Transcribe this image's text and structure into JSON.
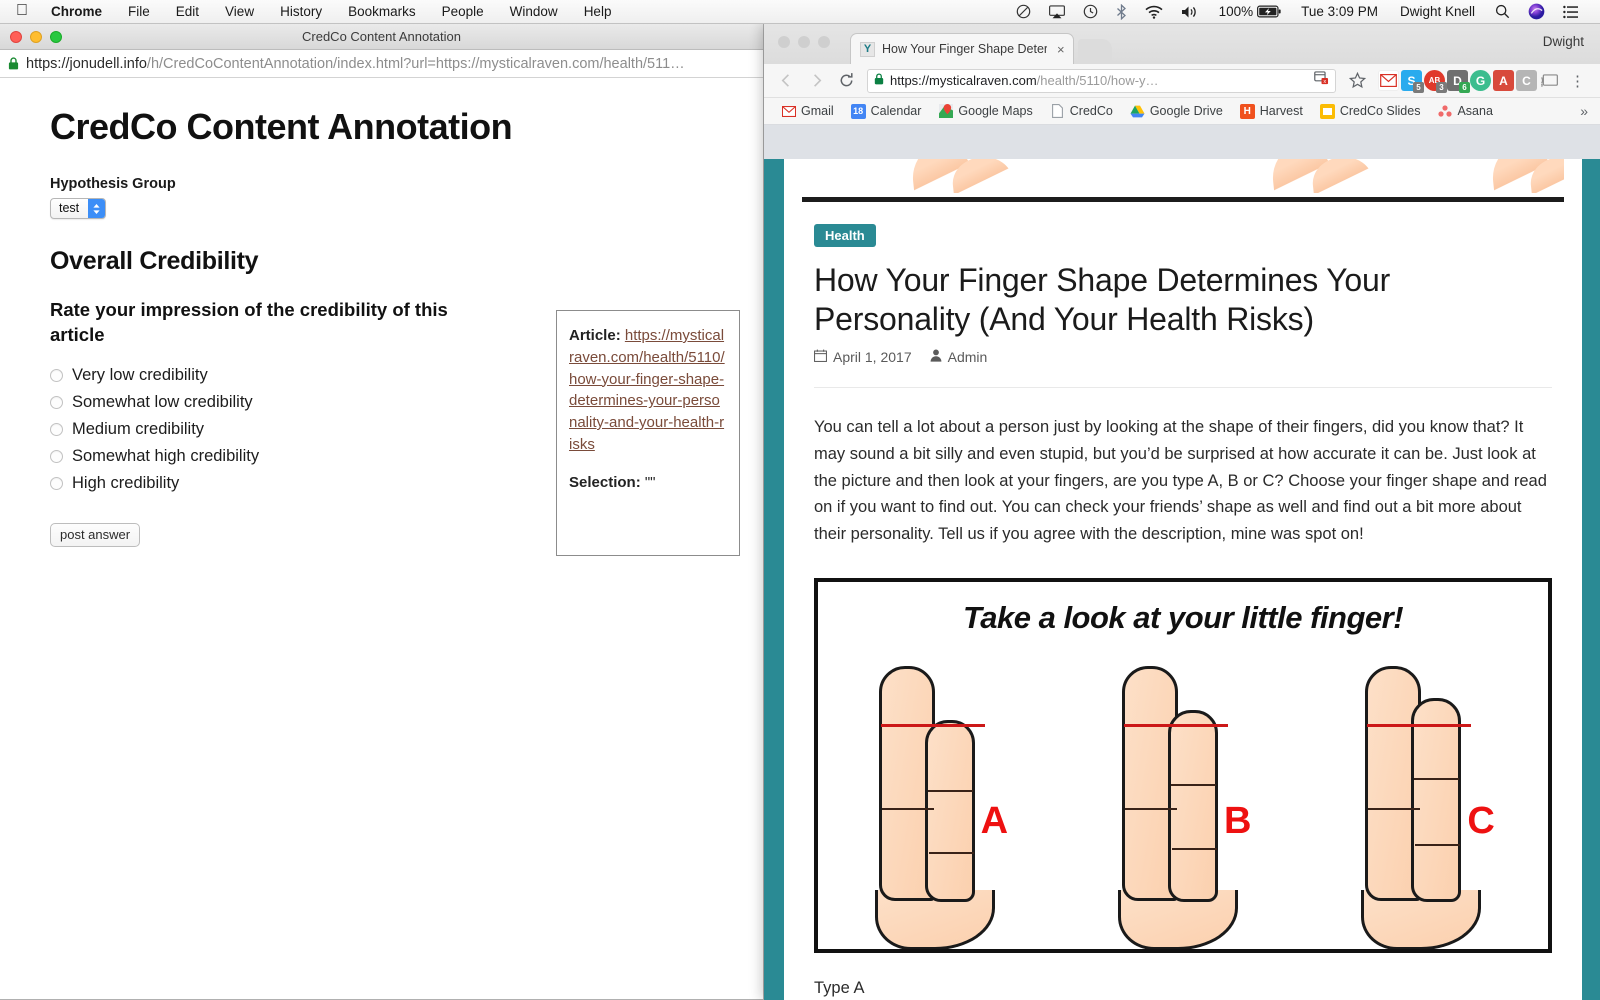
{
  "menubar": {
    "apple": "apple-logo",
    "items": [
      "Chrome",
      "File",
      "Edit",
      "View",
      "History",
      "Bookmarks",
      "People",
      "Window",
      "Help"
    ],
    "status": {
      "battery_percent": "100%",
      "time": "Tue 3:09 PM",
      "user": "Dwight Knell",
      "icons": [
        "do-not-disturb-icon",
        "airplay-icon",
        "time-machine-icon",
        "bluetooth-icon",
        "wifi-icon",
        "volume-icon",
        "battery-icon",
        "spotlight-search-icon",
        "siri-icon",
        "notification-center-icon"
      ]
    }
  },
  "left_window": {
    "title": "CredCo Content Annotation",
    "url_secure_prefix": "https://jonudell.info",
    "url_rest": "/h/CredCoContentAnnotation/index.html?url=https://mysticalraven.com/health/511…",
    "page": {
      "heading": "CredCo Content Annotation",
      "group_label": "Hypothesis Group",
      "group_value": "test",
      "section_heading": "Overall Credibility",
      "question": "Rate your impression of the credibility of this article",
      "options": [
        "Very low credibility",
        "Somewhat low credibility",
        "Medium credibility",
        "Somewhat high credibility",
        "High credibility"
      ],
      "submit_label": "post answer"
    },
    "info_box": {
      "article_label": "Article",
      "article_url": "https://mysticalraven.com/health/5110/how-your-finger-shape-determines-your-personality-and-your-health-risks",
      "selection_label": "Selection",
      "selection_value": "\"\""
    }
  },
  "chrome_window": {
    "profile_name": "Dwight",
    "tab": {
      "title": "How Your Finger Shape Determ",
      "favicon_letter": "Y",
      "close_label": "×"
    },
    "toolbar": {
      "back": "back-icon",
      "forward": "forward-icon",
      "reload": "reload-icon",
      "url_domain": "https://mysticalraven.com",
      "url_path": "/health/5110/how-y…",
      "star": "★",
      "menu": "⋮"
    },
    "extensions": [
      {
        "name": "gmail-checker-extension",
        "glyph": "M",
        "color": "#d93025",
        "bg": "#ffffff",
        "badge": "",
        "badge_color": ""
      },
      {
        "name": "skype-extension",
        "glyph": "S",
        "color": "#ffffff",
        "bg": "#2aabee",
        "badge": "5",
        "badge_color": "#7a7a7a"
      },
      {
        "name": "adblock-extension",
        "glyph": "AB",
        "color": "#ffffff",
        "bg": "#e0392b",
        "badge": "3",
        "badge_color": "#7a7a7a"
      },
      {
        "name": "docs-extension",
        "glyph": "D",
        "color": "#ffffff",
        "bg": "#6f6f6f",
        "badge": "6",
        "badge_color": "#34a853"
      },
      {
        "name": "grammarly-extension",
        "glyph": "G",
        "color": "#ffffff",
        "bg": "#3cbd8e",
        "badge": "",
        "badge_color": ""
      },
      {
        "name": "dictionary-extension",
        "glyph": "A",
        "color": "#ffffff",
        "bg": "#d84a3c",
        "badge": "",
        "badge_color": ""
      },
      {
        "name": "clipboard-extension",
        "glyph": "C",
        "color": "#ffffff",
        "bg": "#b5b5b5",
        "badge": "",
        "badge_color": ""
      },
      {
        "name": "cast-extension",
        "glyph": "⌷",
        "color": "#5f6368",
        "bg": "transparent",
        "badge": "",
        "badge_color": ""
      }
    ],
    "bookmarks": [
      {
        "label": "Gmail",
        "glyph": "M",
        "color": "#d93025",
        "bg": "transparent"
      },
      {
        "label": "Calendar",
        "glyph": "18",
        "color": "#ffffff",
        "bg": "#4285f4"
      },
      {
        "label": "Google Maps",
        "glyph": "◤",
        "color": "#34a853",
        "bg": "#ffffff"
      },
      {
        "label": "CredCo",
        "glyph": "▭",
        "color": "#9aa0a6",
        "bg": "transparent"
      },
      {
        "label": "Google Drive",
        "glyph": "▲",
        "color": "#0f9d58",
        "bg": "transparent"
      },
      {
        "label": "Harvest",
        "glyph": "H",
        "color": "#ffffff",
        "bg": "#f0511e"
      },
      {
        "label": "CredCo Slides",
        "glyph": "▭",
        "color": "#ffffff",
        "bg": "#fbbc04"
      },
      {
        "label": "Asana",
        "glyph": "⁙",
        "color": "#f06a6a",
        "bg": "transparent"
      }
    ],
    "overflow_chevron": "»"
  },
  "webpage": {
    "accent_teal": "#2a8a94",
    "category_badge": "Health",
    "title": "How Your Finger Shape Determines Your Personality (And Your Health Risks)",
    "date": "April 1, 2017",
    "author": "Admin",
    "date_icon": "calendar-icon",
    "author_icon": "user-icon",
    "paragraph": "You can tell a lot about a person just by looking at the shape of their fingers, did you know that? It may sound a bit silly and even stupid, but you’d be surprised at how accurate it can be. Just look at the picture and then look at your fingers, are you type A, B or C? Choose your finger shape and read on if you want to find out. You can check your friends’ shape as well and find out a bit more about their personality. Tell us if you agree with the description, mine was spot on!",
    "figure": {
      "caption": "Take a look at your little finger!",
      "labels": [
        "A",
        "B",
        "C"
      ]
    },
    "next_heading": "Type A"
  }
}
